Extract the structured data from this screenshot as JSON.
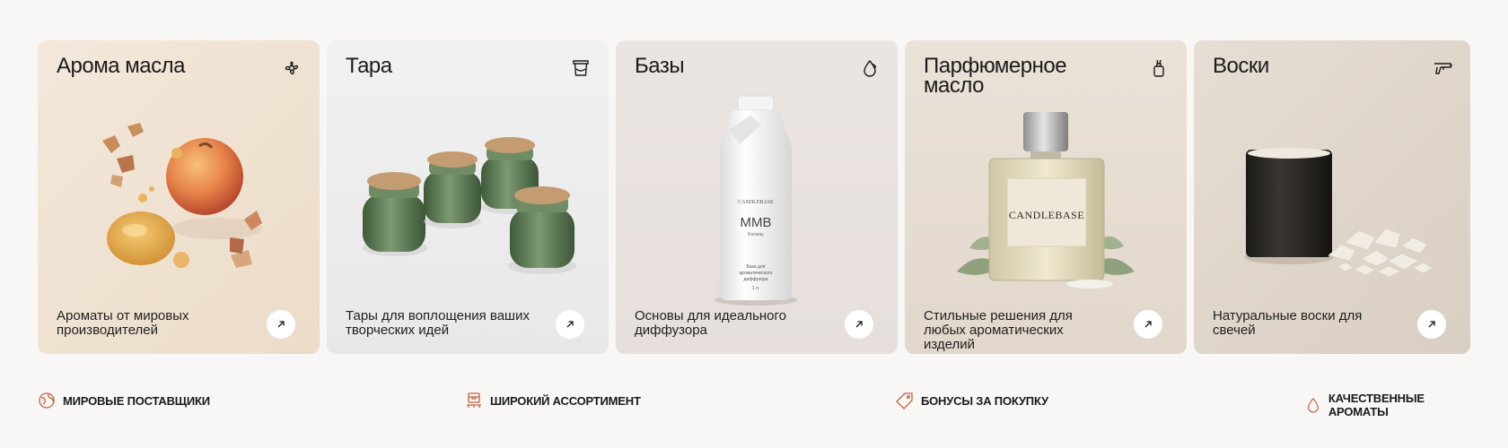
{
  "categories": [
    {
      "title": "Арома масла",
      "icon": "flower-icon",
      "description": "Ароматы от мировых производителей",
      "background": "#f0e4d4"
    },
    {
      "title": "Тара",
      "icon": "jar-icon",
      "description": "Тары для воплощения ваших творческих идей",
      "background": "#eeeeee"
    },
    {
      "title": "Базы",
      "icon": "drop-icon",
      "description": "Основы для идеального диффузора",
      "background": "#ece6e3"
    },
    {
      "title": "Парфюмерное масло",
      "icon": "perfume-icon",
      "description": "Стильные решения для любых ароматических изделий",
      "background": "#e7ddd2"
    },
    {
      "title": "Воски",
      "icon": "wax-gun-icon",
      "description": "Натуральные воски для свечей",
      "background": "#e3dad0"
    }
  ],
  "product_labels": {
    "bottle_brand": "CANDLEBASE",
    "bottle_name": "MMB",
    "bottle_sub": "Kuraray",
    "bottle_desc1": "База для",
    "bottle_desc2": "ароматического",
    "bottle_desc3": "диффузора",
    "bottle_volume": "1 л.",
    "perfume_brand": "CANDLEBASE"
  },
  "features": [
    {
      "label": "Мировые поставщики",
      "icon": "globe-icon"
    },
    {
      "label": "Широкий ассортимент",
      "icon": "boxes-icon"
    },
    {
      "label": "Бонусы за покупку",
      "icon": "tag-icon"
    },
    {
      "label": "Качественные ароматы",
      "icon": "drop-icon"
    }
  ],
  "colors": {
    "accent": "#c5623a",
    "page_background": "#f8f7f5"
  }
}
